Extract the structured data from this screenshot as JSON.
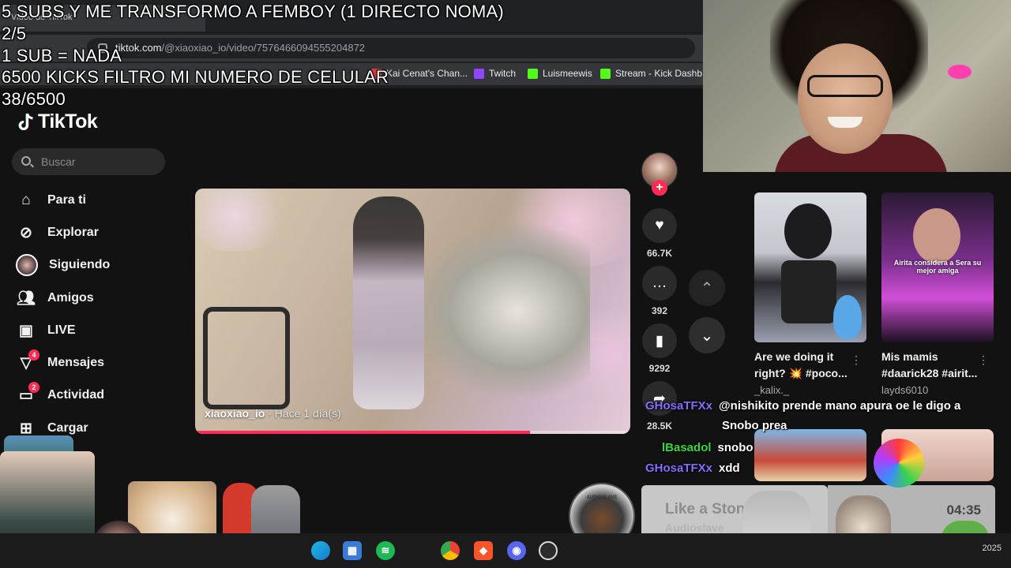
{
  "browser": {
    "tab_title": "Video de TikTok",
    "url_host": "tiktok.com",
    "url_path": "/@xiaoxiao_io/video/7576466094555204872",
    "bookmarks": [
      {
        "label": "Kai Cenat's Chan...",
        "color": "#e53935"
      },
      {
        "label": "Twitch",
        "color": "#9146ff"
      },
      {
        "label": "Luismeewis",
        "color": "#53fc18"
      },
      {
        "label": "Stream - Kick Dashb...",
        "color": "#53fc18"
      }
    ]
  },
  "overlay": {
    "line1": "5 SUBS Y ME TRANSFORMO A FEMBOY (1 DIRECTO NOMA)",
    "line2": "2/5",
    "line3": "1 SUB = NADA",
    "line4": "6500 KICKS FILTRO MI NUMERO DE CELULAR",
    "line5": "38/6500"
  },
  "tiktok": {
    "logo": "TikTok",
    "search_placeholder": "Buscar",
    "nav": [
      {
        "label": "Para ti",
        "icon": "home-icon",
        "badge": ""
      },
      {
        "label": "Explorar",
        "icon": "compass-icon",
        "badge": ""
      },
      {
        "label": "Siguiendo",
        "icon": "following-avatar-icon",
        "badge": ""
      },
      {
        "label": "Amigos",
        "icon": "friends-icon",
        "badge": ""
      },
      {
        "label": "LIVE",
        "icon": "live-icon",
        "badge": ""
      },
      {
        "label": "Mensajes",
        "icon": "messages-icon",
        "badge": "4"
      },
      {
        "label": "Actividad",
        "icon": "activity-icon",
        "badge": "2"
      },
      {
        "label": "Cargar",
        "icon": "upload-icon",
        "badge": ""
      }
    ],
    "video": {
      "author": "xiaoxiao_io",
      "time": " · Hace 1 día(s)",
      "progress": 0.77
    },
    "actions": {
      "likes": "66.7K",
      "comments": "392",
      "saves": "9292",
      "shares": "28.5K"
    },
    "cards": [
      {
        "title": "Are we doing it right? 💥 #poco...",
        "author": "_kalix._",
        "overlay": ""
      },
      {
        "title": "Mis mamis #daarick28 #airit...",
        "author": "layds6010",
        "overlay": "Airita considera a Sera su mejor amiga"
      }
    ]
  },
  "chat": [
    {
      "user": "GHosaTFXx",
      "msg": "@nishikito prende mano apura oe le digo a",
      "color": "purple"
    },
    {
      "user": "",
      "msg": "Snobo prea",
      "color": ""
    },
    {
      "user": "lBasadol",
      "msg": "snobo",
      "color": "green"
    },
    {
      "user": "GHosaTFXx",
      "msg": "xdd",
      "color": "purple"
    }
  ],
  "now_playing": {
    "title": "Like a Stone",
    "artist": "Audioslave",
    "time": "04:35",
    "album_label": "AUDIOSLAVE"
  },
  "taskbar": {
    "icons": [
      "edge-icon",
      "store-icon",
      "spotify-icon",
      "chrome-icon",
      "brave-icon",
      "discord-icon",
      "obs-icon"
    ],
    "clock": "2025"
  },
  "colors": {
    "accent": "#fe2c55",
    "chat_green": "#37d93c",
    "chat_purple": "#8a6bff",
    "tiktok_bg": "#121212"
  }
}
